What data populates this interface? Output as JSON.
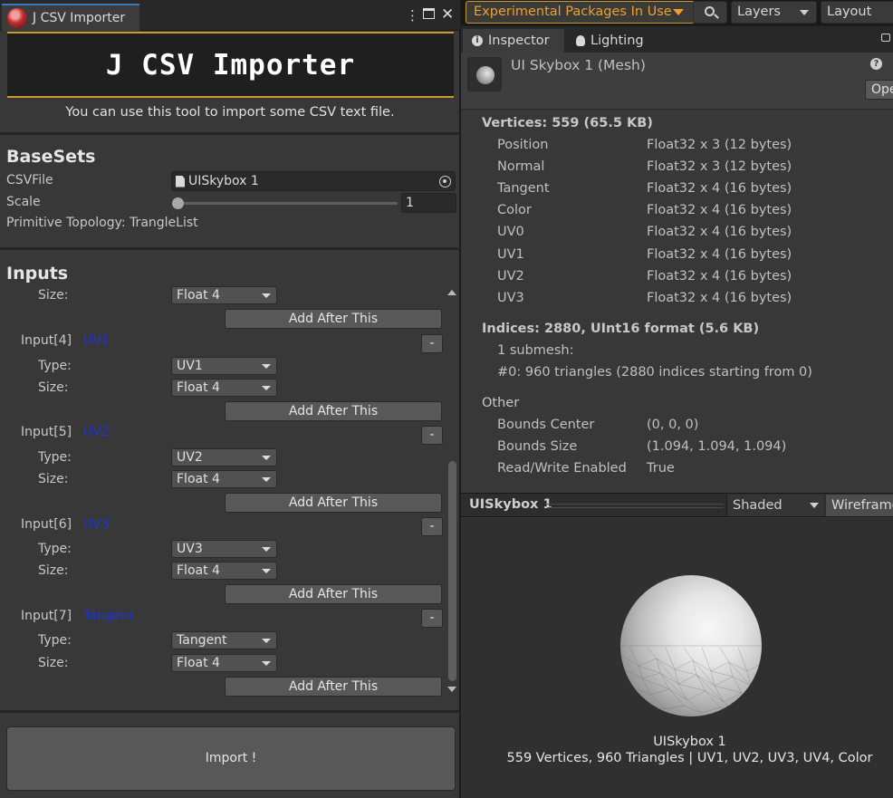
{
  "csv_window": {
    "tab_title": "J CSV Importer",
    "banner_title": "J CSV Importer",
    "subtitle": "You can use this tool to import some CSV text file.",
    "basesets": {
      "title": "BaseSets",
      "csvfile_label": "CSVFile",
      "csvfile_value": "UISkybox 1",
      "scale_label": "Scale",
      "scale_value": "1",
      "topology_text": "Primitive Topology: TrangleList"
    },
    "inputs": {
      "title": "Inputs",
      "top_size_label": "Size:",
      "top_size_value": "Float 4",
      "add_after_label": "Add After This",
      "minus_label": "-",
      "type_label": "Type:",
      "size_label": "Size:",
      "items": [
        {
          "title": "Input[4]",
          "kind": "UV1",
          "type": "UV1",
          "size": "Float 4"
        },
        {
          "title": "Input[5]",
          "kind": "UV2",
          "type": "UV2",
          "size": "Float 4"
        },
        {
          "title": "Input[6]",
          "kind": "UV3",
          "type": "UV3",
          "size": "Float 4"
        },
        {
          "title": "Input[7]",
          "kind": "Tangent",
          "type": "Tangent",
          "size": "Float 4"
        }
      ]
    },
    "import_label": "Import !"
  },
  "toolbar": {
    "packages_label": "Experimental Packages In Use",
    "layers_label": "Layers",
    "layout_label": "Layout"
  },
  "inspector": {
    "tab_inspector": "Inspector",
    "tab_lighting": "Lighting",
    "mesh_name": "UI Skybox 1 (Mesh)",
    "open_label": "Ope",
    "vertices_header": "Vertices: 559 (65.5 KB)",
    "attributes": [
      {
        "name": "Position",
        "format": "Float32 x 3 (12 bytes)"
      },
      {
        "name": "Normal",
        "format": "Float32 x 3 (12 bytes)"
      },
      {
        "name": "Tangent",
        "format": "Float32 x 4 (16 bytes)"
      },
      {
        "name": "Color",
        "format": "Float32 x 4 (16 bytes)"
      },
      {
        "name": "UV0",
        "format": "Float32 x 4 (16 bytes)"
      },
      {
        "name": "UV1",
        "format": "Float32 x 4 (16 bytes)"
      },
      {
        "name": "UV2",
        "format": "Float32 x 4 (16 bytes)"
      },
      {
        "name": "UV3",
        "format": "Float32 x 4 (16 bytes)"
      }
    ],
    "indices_header": "Indices: 2880, UInt16 format (5.6 KB)",
    "submesh_count": "1 submesh:",
    "submesh_detail": "#0: 960 triangles (2880 indices starting from 0)",
    "other_header": "Other",
    "other": [
      {
        "name": "Bounds Center",
        "value": "(0, 0, 0)"
      },
      {
        "name": "Bounds Size",
        "value": "(1.094, 1.094, 1.094)"
      },
      {
        "name": "Read/Write Enabled",
        "value": "True"
      }
    ]
  },
  "preview": {
    "title": "UISkybox 1",
    "shading_mode": "Shaded",
    "wireframe_label": "Wireframe",
    "caption_name": "UISkybox 1",
    "caption_stats": "559 Vertices, 960 Triangles | UV1, UV2, UV3, UV4, Color"
  }
}
